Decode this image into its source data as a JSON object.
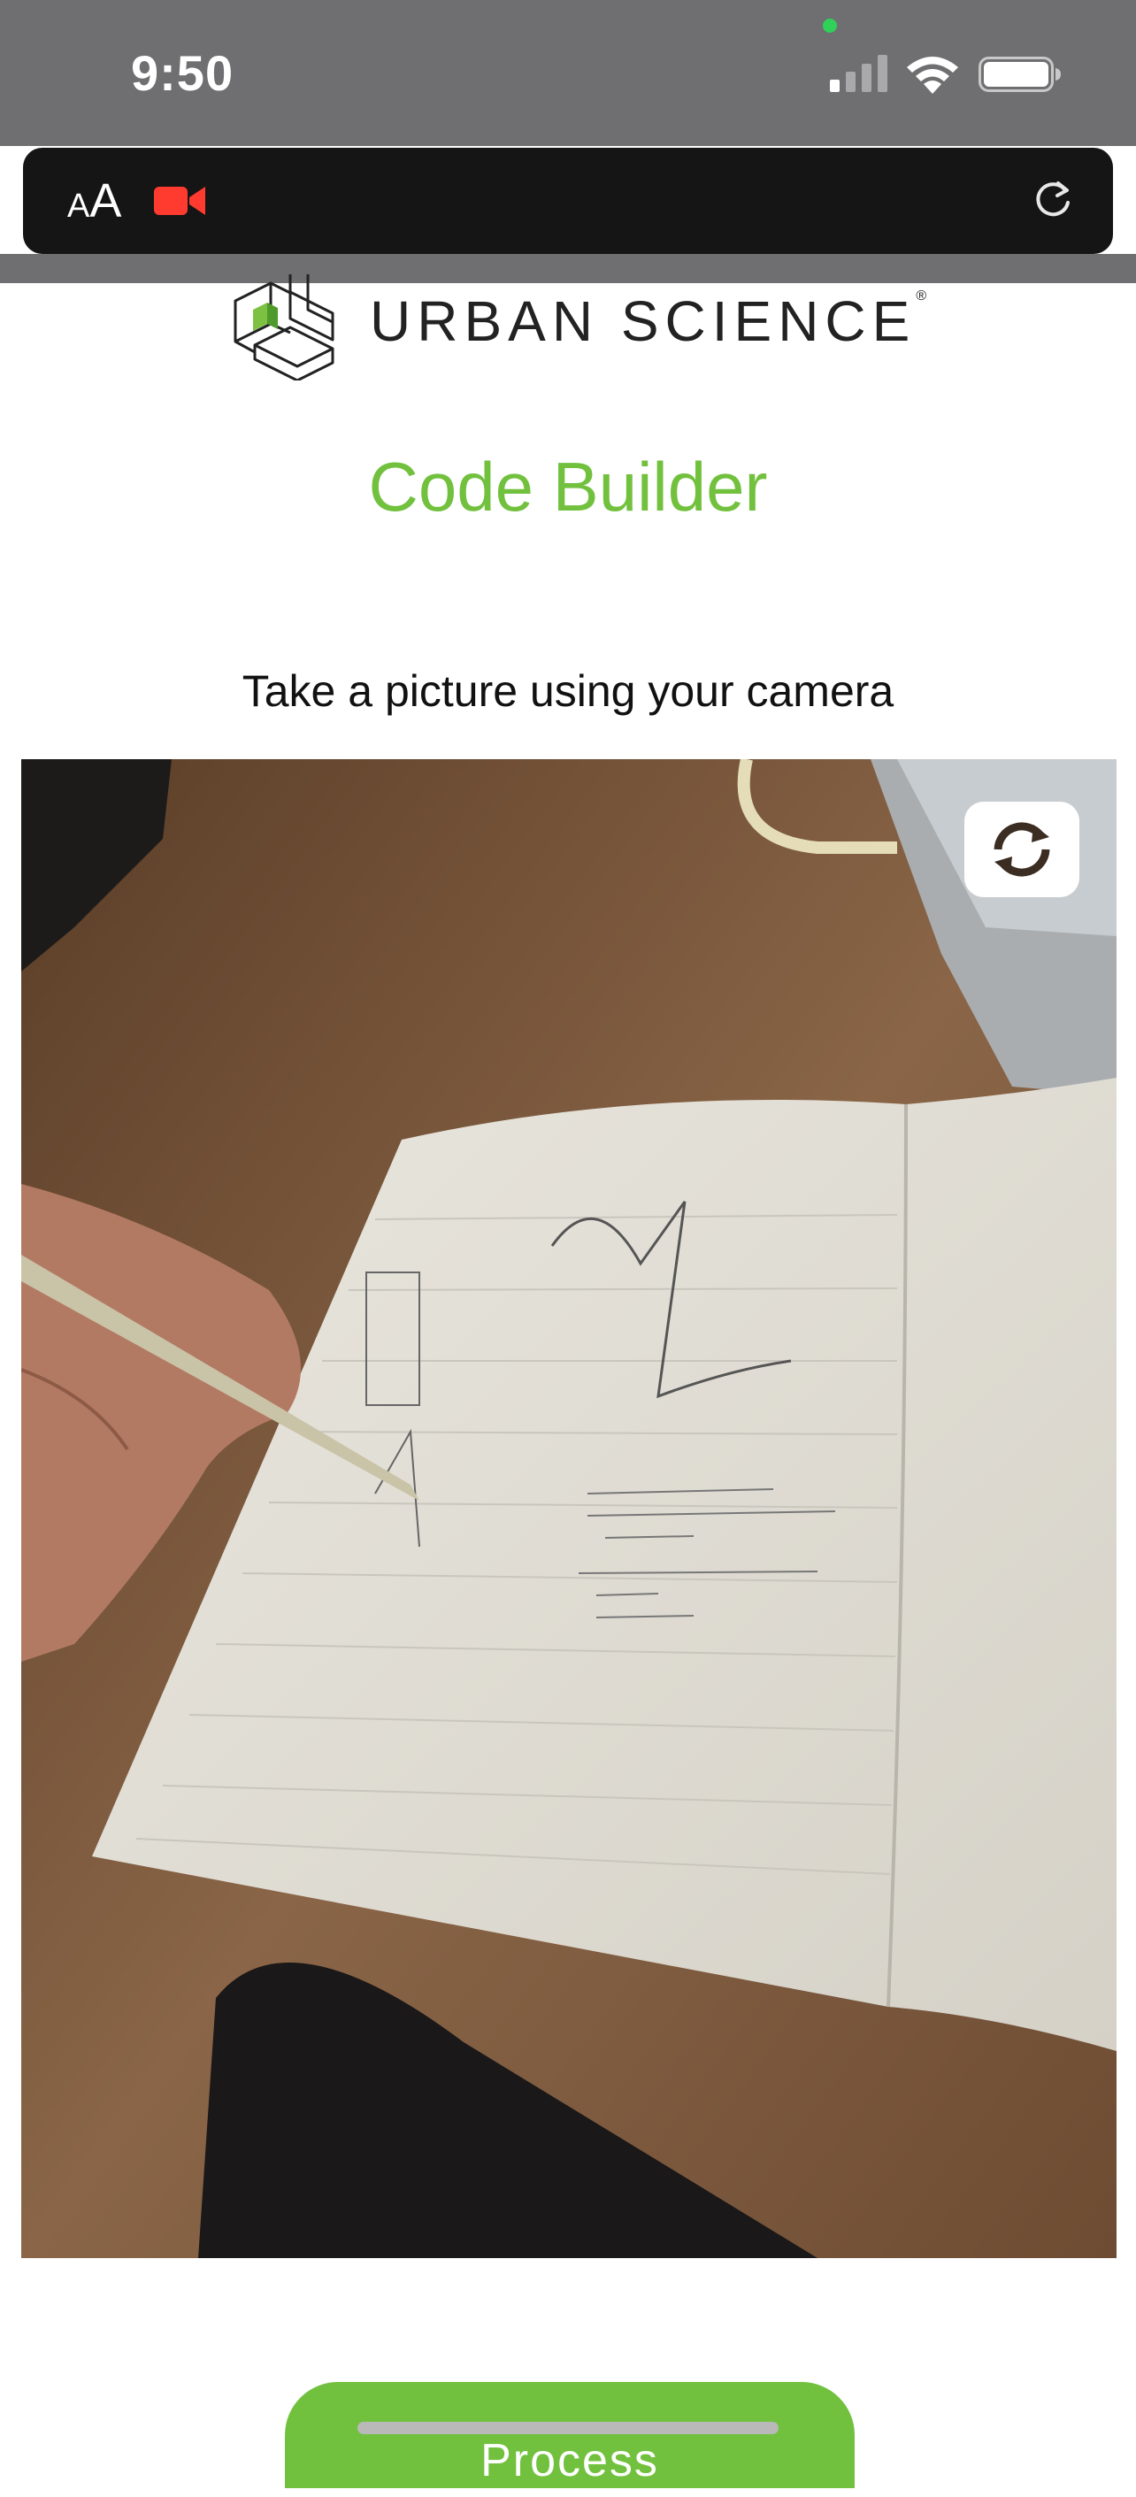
{
  "status_bar": {
    "time": "9:50",
    "icons": [
      "signal-icon",
      "wifi-icon",
      "battery-icon"
    ],
    "privacy_indicator_color": "#30d158"
  },
  "browser": {
    "text_size_label_small": "A",
    "text_size_label_large": "A",
    "icons": [
      "camera-in-use-icon",
      "reload-icon"
    ]
  },
  "header": {
    "brand_name": "URBAN SCIENCE",
    "registered_mark": "®"
  },
  "page": {
    "title": "Code Builder",
    "instruction": "Take a picture using your camera",
    "process_label": "Process"
  },
  "colors": {
    "accent": "#72c13e",
    "status_bar": "#6f6f71",
    "address_bar": "#151515",
    "camera_indicator": "#ff3b30"
  }
}
